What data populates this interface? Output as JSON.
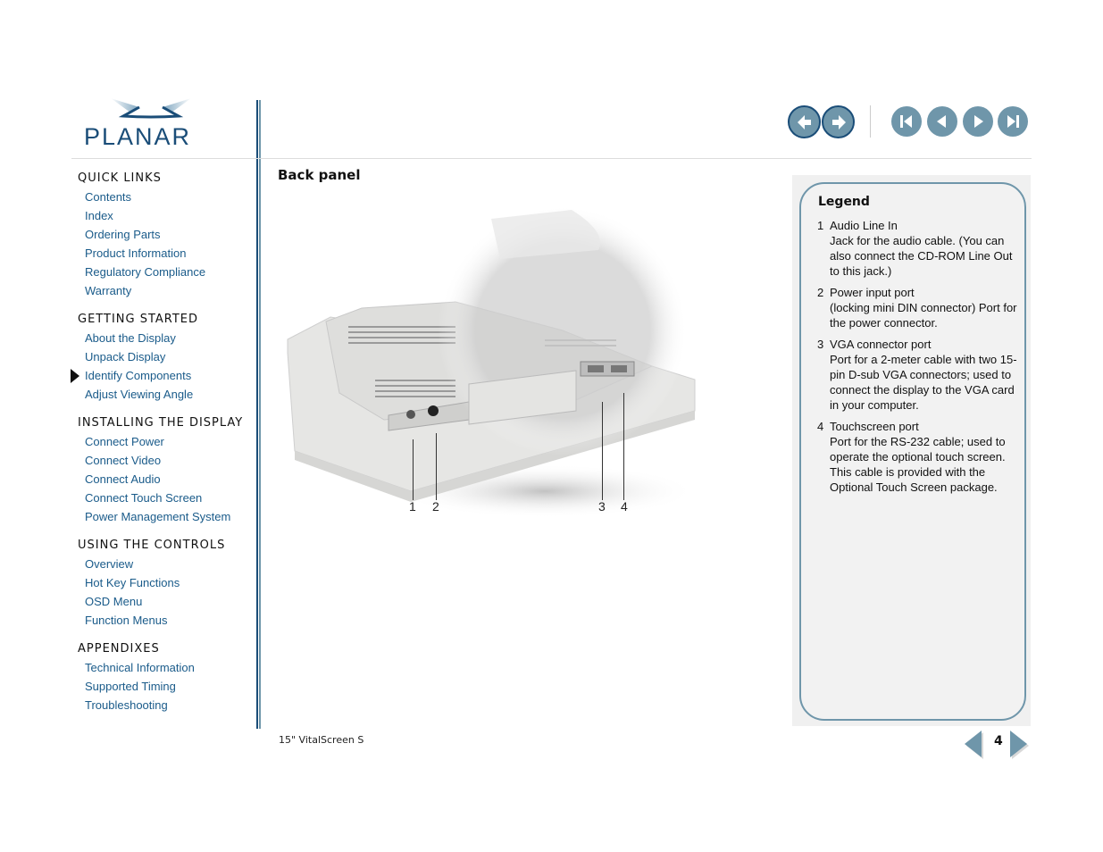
{
  "brand": {
    "name": "PLANAR",
    "color": "#1a4d78",
    "accent": "#6f96aa"
  },
  "toolbar": {
    "buttons": [
      {
        "name": "back-button",
        "icon": "arrow-left-icon"
      },
      {
        "name": "forward-button",
        "icon": "arrow-right-icon"
      },
      {
        "name": "first-page-button",
        "icon": "skip-first-icon"
      },
      {
        "name": "previous-page-button",
        "icon": "triangle-left-icon"
      },
      {
        "name": "next-page-button",
        "icon": "triangle-right-icon"
      },
      {
        "name": "last-page-button",
        "icon": "skip-last-icon"
      }
    ]
  },
  "sidebar": {
    "sections": [
      {
        "title": "QUICK LINKS",
        "items": [
          "Contents",
          "Index",
          "Ordering Parts",
          "Product Information",
          "Regulatory Compliance",
          "Warranty"
        ]
      },
      {
        "title": "GETTING STARTED",
        "items": [
          "About the Display",
          "Unpack Display",
          "Identify Components",
          "Adjust Viewing Angle"
        ]
      },
      {
        "title": "INSTALLING THE DISPLAY",
        "items": [
          "Connect Power",
          "Connect Video",
          "Connect Audio",
          "Connect Touch Screen",
          "Power Management System"
        ]
      },
      {
        "title": "USING THE CONTROLS",
        "items": [
          "Overview",
          "Hot Key Functions",
          "OSD Menu",
          "Function Menus"
        ]
      },
      {
        "title": "APPENDIXES",
        "items": [
          "Technical Information",
          "Supported Timing",
          "Troubleshooting"
        ]
      }
    ],
    "current": "Identify Components"
  },
  "main": {
    "heading": "Back panel",
    "figure": {
      "description": "Back panel of monitor with stand",
      "callouts": [
        "1",
        "2",
        "3",
        "4"
      ]
    }
  },
  "legend": {
    "title": "Legend",
    "items": [
      {
        "num": "1",
        "title": "Audio Line In",
        "desc": "Jack for the audio cable. (You can also connect the CD-ROM Line Out to this jack.)"
      },
      {
        "num": "2",
        "title": "Power input port",
        "desc": "(locking mini DIN connector) Port for the power connector."
      },
      {
        "num": "3",
        "title": "VGA connector port",
        "desc": "Port for a 2-meter cable with two 15-pin D-sub VGA connectors; used to connect the display to the VGA card in your computer."
      },
      {
        "num": "4",
        "title": "Touchscreen port",
        "desc": "Port for the RS-232 cable; used to operate the optional touch screen. This cable is provided with the Optional Touch Screen package."
      }
    ]
  },
  "footer": {
    "product": "15\" VitalScreen S",
    "page_number": "4"
  }
}
